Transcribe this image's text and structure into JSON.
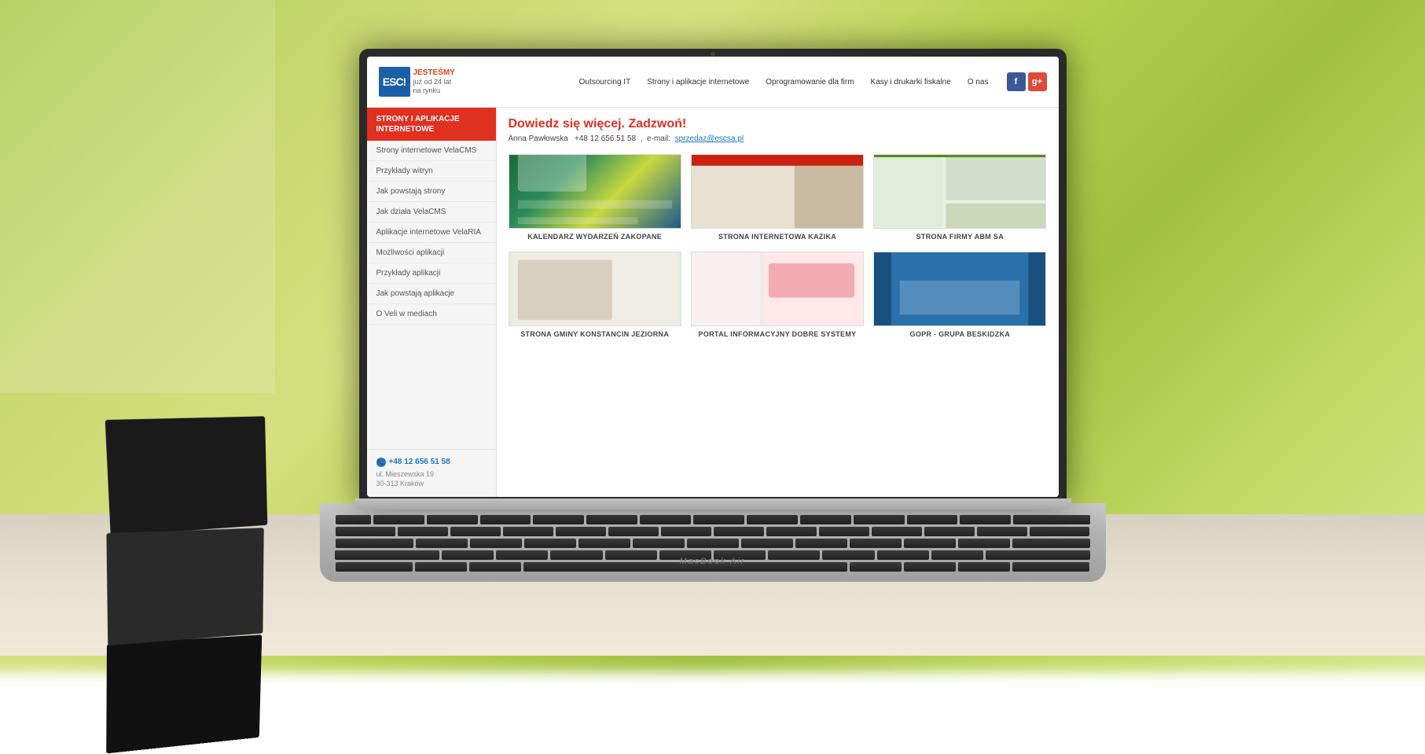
{
  "background": {
    "color": "#a8c84a"
  },
  "laptop": {
    "brand": "MacBook Air"
  },
  "website": {
    "header": {
      "logo_text": "ESC!",
      "logo_tagline_1": "JESTEŚMY",
      "logo_tagline_2": "już od 24 lat",
      "logo_tagline_3": "na rynku",
      "nav": [
        {
          "label": "Outsourcing IT"
        },
        {
          "label": "Strony i aplikacje internetowe"
        },
        {
          "label": "Oprogramowanie dla firm"
        },
        {
          "label": "Kasy i drukarki fiskalne"
        },
        {
          "label": "O nas"
        }
      ],
      "social": {
        "facebook": "f",
        "google_plus": "g+"
      }
    },
    "sidebar": {
      "active_item": "STRONY I APLIKACJE INTERNETOWE",
      "links": [
        "Strony internetowe VelaCMS",
        "Przykłady witryn",
        "Jak powstają strony",
        "Jak działa VelaCMS",
        "Aplikacje internetowe VelaRIA",
        "Możliwości aplikacji",
        "Przykłady aplikacji",
        "Jak powstają aplikacje",
        "O Veli w mediach"
      ],
      "phone": "+48 12 656 51 58",
      "address_line1": "ul. Mieszewska 19",
      "address_line2": "30-313 Kraków"
    },
    "content": {
      "cta_heading": "Dowiedz się więcej. Zadzwoń!",
      "cta_name": "Anna Pawłowska",
      "cta_phone": "+48 12 656 51 58",
      "cta_email_label": "e-mail:",
      "cta_email": "sprzedaz@escsa.pl",
      "portfolio": [
        {
          "title": "KALENDARZ WYDARZEŃ ZAKOPANE",
          "thumb_class": "thumb-1"
        },
        {
          "title": "STRONA INTERNETOWA KAZIKA",
          "thumb_class": "thumb-2"
        },
        {
          "title": "STRONA FIRMY ABM SA",
          "thumb_class": "thumb-3"
        },
        {
          "title": "STRONA GMINY KONSTANCIN JEZIORNA",
          "thumb_class": "thumb-4"
        },
        {
          "title": "PORTAL INFORMACYJNY DOBRE SYSTEMY",
          "thumb_class": "thumb-5"
        },
        {
          "title": "GOPR - GRUPA BESKIDZKA",
          "thumb_class": "thumb-6"
        }
      ]
    }
  }
}
